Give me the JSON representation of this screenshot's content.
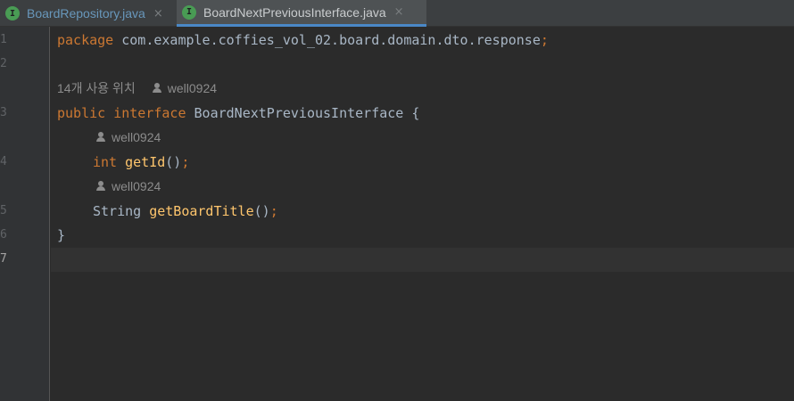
{
  "tabs": [
    {
      "icon": "I",
      "label": "BoardRepository.java",
      "close": "×",
      "active": false
    },
    {
      "icon": "I",
      "label": "BoardNextPreviousInterface.java",
      "close": "×",
      "active": true
    }
  ],
  "gutter": {
    "line_numbers": [
      "1",
      "2",
      "3",
      "4",
      "5",
      "6",
      "7"
    ],
    "current_line": "7"
  },
  "code": {
    "line1": {
      "keyword": "package",
      "rest": " com.example.coffies_vol_02.board.domain.dto.response",
      "semicolon": ";"
    },
    "usages_hint": {
      "text": "14개 사용 위치",
      "author": "well0924"
    },
    "line3": {
      "kw1": "public",
      "kw2": "interface",
      "rest": " BoardNextPreviousInterface {"
    },
    "author_hint_1": "well0924",
    "line4": {
      "type_kw": "int",
      "method": "getId",
      "parens": "()",
      "semicolon": ";"
    },
    "author_hint_2": "well0924",
    "line5": {
      "type": "String",
      "method": "getBoardTitle",
      "parens": "()",
      "semicolon": ";"
    },
    "line6": "}"
  },
  "colors": {
    "background": "#2b2b2b",
    "keyword": "#cc7832",
    "method": "#ffc66d",
    "text": "#a9b7c6",
    "hint": "#8c8c8c",
    "tab_inactive_text": "#6897bb",
    "tab_active_underline": "#4a88c7",
    "interface_icon": "#499c54"
  }
}
